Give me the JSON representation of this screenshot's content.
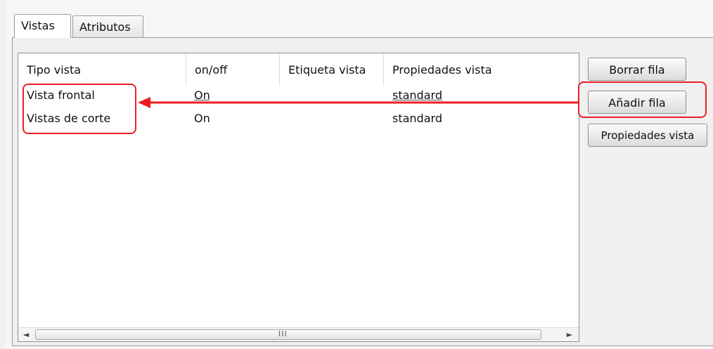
{
  "tabs": [
    {
      "label": "Vistas",
      "active": true
    },
    {
      "label": "Atributos",
      "active": false
    }
  ],
  "table": {
    "columns": [
      "Tipo vista",
      "on/off",
      "Etiqueta vista",
      "Propiedades vista"
    ],
    "rows": [
      {
        "tipo": "Vista frontal",
        "onoff": "On",
        "etiqueta": "",
        "propiedades": "standard"
      },
      {
        "tipo": "Vistas de corte",
        "onoff": "On",
        "etiqueta": "",
        "propiedades": "standard"
      }
    ]
  },
  "scrollbar": {
    "left_icon": "scroll-left-icon",
    "right_icon": "scroll-right-icon",
    "left_glyph": "◄",
    "right_glyph": "►",
    "grip": "III"
  },
  "buttons": {
    "borrar": "Borrar fila",
    "anadir": "Añadir fila",
    "propiedades": "Propiedades vista"
  },
  "annotation_color": "#ee1c24"
}
